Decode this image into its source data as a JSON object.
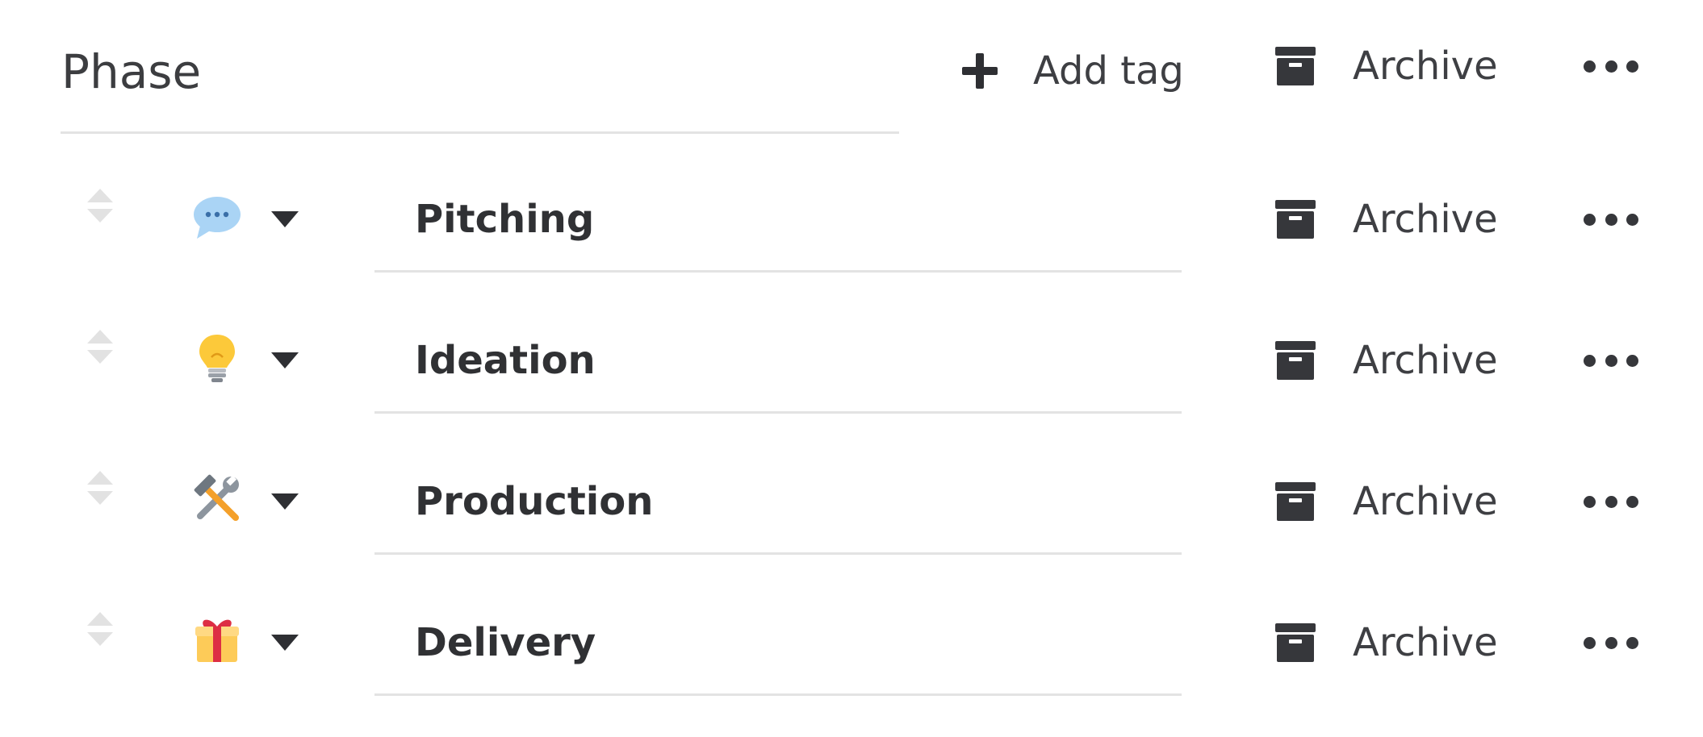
{
  "header": {
    "title": "Phase",
    "add_tag_label": "Add tag",
    "archive_label": "Archive"
  },
  "tags": [
    {
      "name": "Pitching",
      "emoji": "speech-bubble-icon",
      "archive_label": "Archive"
    },
    {
      "name": "Ideation",
      "emoji": "light-bulb-icon",
      "archive_label": "Archive"
    },
    {
      "name": "Production",
      "emoji": "hammer-and-wrench-icon",
      "archive_label": "Archive"
    },
    {
      "name": "Delivery",
      "emoji": "gift-icon",
      "archive_label": "Archive"
    }
  ],
  "colors": {
    "text": "#333438",
    "icon": "#36373b",
    "divider": "#e3e3e3",
    "drag_handle": "#e2e2e2"
  }
}
